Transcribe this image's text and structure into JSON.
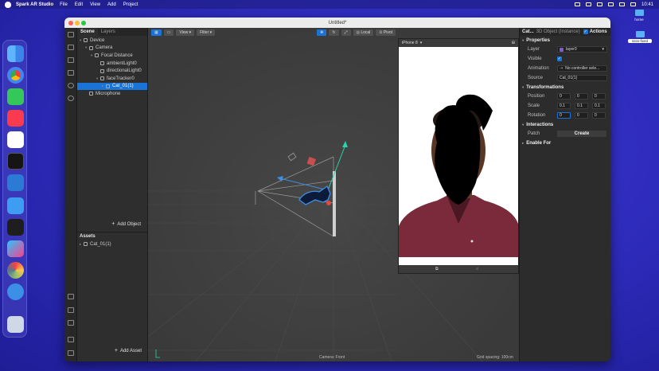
{
  "menubar": {
    "app": "Spark AR Studio",
    "items": [
      "File",
      "Edit",
      "View",
      "Add",
      "Project"
    ],
    "clock": "10:41"
  },
  "desktop": {
    "icons": [
      {
        "label": "home"
      },
      {
        "label": "ssss-fixed"
      }
    ]
  },
  "window": {
    "title": "Untitled*"
  },
  "scene_panel": {
    "tabs": [
      "Scene",
      "Layers"
    ],
    "tree": [
      {
        "label": "Device",
        "depth": 0,
        "arrow": "▾",
        "selected": false
      },
      {
        "label": "Camera",
        "depth": 1,
        "arrow": "▾",
        "selected": false
      },
      {
        "label": "Focal Distance",
        "depth": 2,
        "arrow": "▾",
        "selected": false
      },
      {
        "label": "ambientLight0",
        "depth": 3,
        "arrow": "",
        "selected": false
      },
      {
        "label": "directionalLight0",
        "depth": 3,
        "arrow": "",
        "selected": false
      },
      {
        "label": "faceTracker0",
        "depth": 3,
        "arrow": "▾",
        "selected": false
      },
      {
        "label": "Cat_01(1)",
        "depth": 4,
        "arrow": "▸",
        "selected": true
      },
      {
        "label": "Microphone",
        "depth": 1,
        "arrow": "",
        "selected": false
      }
    ],
    "add_object": "Add Object"
  },
  "assets_panel": {
    "title": "Assets",
    "items": [
      "Cat_01(1)"
    ],
    "add_asset": "Add Asset"
  },
  "viewport": {
    "toolbar": {
      "view": "View",
      "filter": "Filter",
      "local": "Local",
      "pivot": "Pivot"
    },
    "footer_camera": "Camera: Front",
    "footer_grid": "Grid spacing: 100cm"
  },
  "simulator": {
    "device": "iPhone 8"
  },
  "inspector": {
    "object_name": "Cat...",
    "object_type": "3D Object (Instance)",
    "actions": "Actions",
    "properties": {
      "title": "Properties",
      "layer_label": "Layer",
      "layer_value": "layer0",
      "visible_label": "Visible",
      "animation_label": "Animation",
      "animation_value": "No controller sele...",
      "source_label": "Source",
      "source_value": "Cat_01(1)"
    },
    "transformations": {
      "title": "Transformations",
      "position_label": "Position",
      "position": [
        "0",
        "0",
        "0"
      ],
      "scale_label": "Scale",
      "scale": [
        "0.1",
        "0.1",
        "0.1"
      ],
      "rotation_label": "Rotation",
      "rotation": [
        "0",
        "0",
        "0"
      ]
    },
    "interactions": {
      "title": "Interactions",
      "patch_label": "Patch",
      "create": "Create"
    },
    "enable_for": "Enable For"
  },
  "colors": {
    "accent": "#1a73d6",
    "gizmo_green": "#2ed1a8",
    "gizmo_red": "#c6504e"
  }
}
